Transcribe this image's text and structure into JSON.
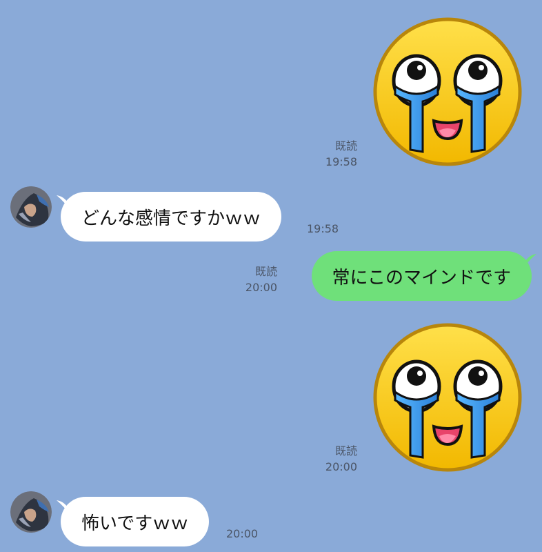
{
  "messages": [
    {
      "type": "sticker",
      "side": "right",
      "sticker": "crying-laughing-face-sticker",
      "read": "既読",
      "time": "19:58"
    },
    {
      "type": "text",
      "side": "left",
      "text": "どんな感情ですかｗｗ",
      "time": "19:58"
    },
    {
      "type": "text",
      "side": "right",
      "text": "常にこのマインドです",
      "read": "既読",
      "time": "20:00"
    },
    {
      "type": "sticker",
      "side": "right",
      "sticker": "crying-laughing-face-sticker",
      "read": "既読",
      "time": "20:00"
    },
    {
      "type": "text",
      "side": "left",
      "text": "怖いですｗｗ",
      "time": "20:00"
    }
  ],
  "colors": {
    "background": "#8aaad8",
    "incoming_bubble": "#ffffff",
    "outgoing_bubble": "#6fe07a",
    "meta_text": "#4b5566",
    "sticker_face": "#f7c600",
    "tears": "#3b8de0"
  }
}
